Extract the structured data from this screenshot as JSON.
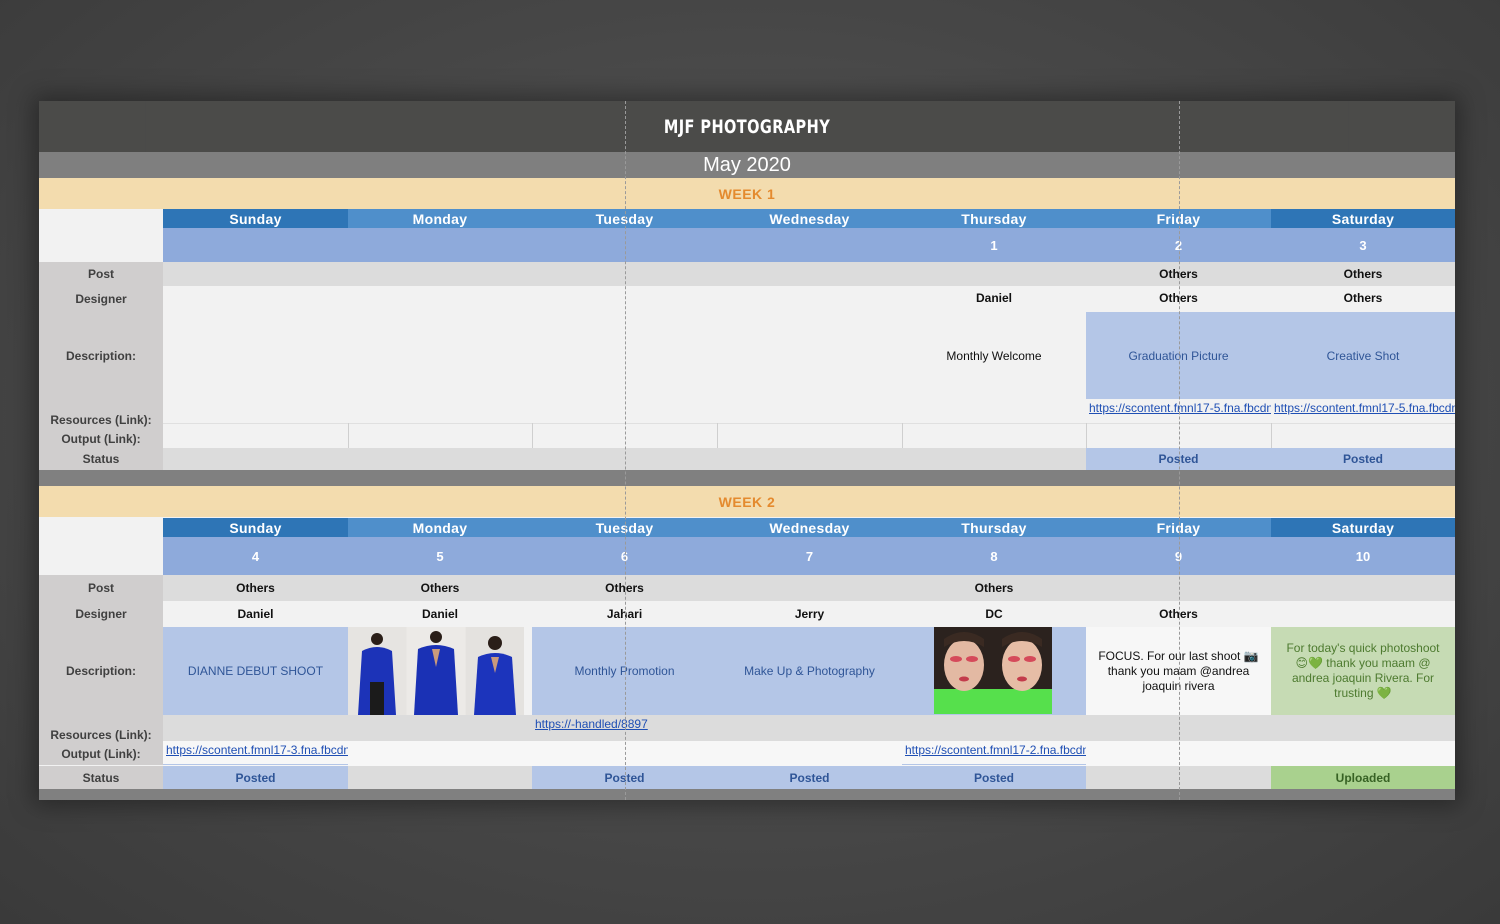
{
  "sheet": {
    "title": "MJF PHOTOGRAPHY",
    "month": "May 2020"
  },
  "labels": {
    "post": "Post",
    "designer": "Designer",
    "description": "Description:",
    "resources": "Resources (Link):",
    "output": "Output (Link):",
    "status": "Status"
  },
  "days": [
    "Sunday",
    "Monday",
    "Tuesday",
    "Wednesday",
    "Thursday",
    "Friday",
    "Saturday"
  ],
  "week1": {
    "label": "WEEK 1",
    "dates": [
      "",
      "",
      "",
      "",
      "1",
      "2",
      "3"
    ],
    "post": [
      "",
      "",
      "",
      "",
      "",
      "Others",
      "Others"
    ],
    "designer": [
      "",
      "",
      "",
      "",
      "Daniel",
      "Others",
      "Others"
    ],
    "description": [
      "",
      "",
      "",
      "",
      "Monthly Welcome",
      "Graduation Picture",
      "Creative Shot"
    ],
    "resources": [
      "",
      "",
      "",
      "",
      "",
      "https://scontent.fmnl17-5.fna.fbcdn",
      "https://scontent.fmnl17-5.fna.fbcdn"
    ],
    "status": [
      "",
      "",
      "",
      "",
      "",
      "Posted",
      "Posted"
    ]
  },
  "week2": {
    "label": "WEEK 2",
    "dates": [
      "4",
      "5",
      "6",
      "7",
      "8",
      "9",
      "10"
    ],
    "post": [
      "Others",
      "Others",
      "Others",
      "",
      "Others",
      "",
      ""
    ],
    "designer": [
      "Daniel",
      "Daniel",
      "Jahari",
      "Jerry",
      "DC",
      "Others",
      ""
    ],
    "description": [
      "DIANNE DEBUT SHOOT",
      "",
      "Monthly Promotion",
      "Make Up & Photography",
      "",
      "FOCUS. For our last shoot 📷 thank you maam @andrea joaquin rivera",
      "For today's quick photoshoot 😊💚 thank you maam @ andrea joaquin Rivera. For trusting 💚"
    ],
    "resources": [
      "",
      "",
      "https://-handled/8897",
      "",
      "",
      "",
      ""
    ],
    "output": [
      "https://scontent.fmnl17-3.fna.fbcdn",
      "",
      "",
      "",
      "https://scontent.fmnl17-2.fna.fbcdn",
      "",
      ""
    ],
    "status": [
      "Posted",
      "",
      "Posted",
      "Posted",
      "Posted",
      "",
      "Uploaded"
    ]
  },
  "colors": {
    "title_band": "#4b4b49",
    "month_band": "#7f7f7f",
    "week_band": "#f3dcae",
    "week_text": "#e48a2e",
    "day_header": "#2e75b6",
    "date_row": "#8eaadb",
    "desc_blue": "#b4c6e7",
    "desc_green": "#c6dbb4",
    "uploaded": "#a9d18e"
  }
}
